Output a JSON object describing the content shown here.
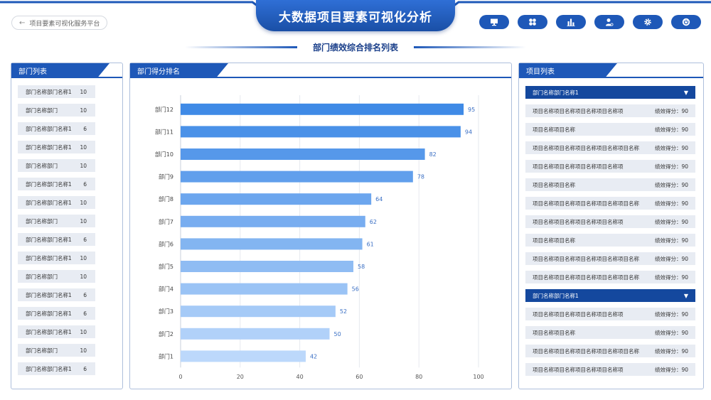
{
  "header": {
    "title": "大数据项目要素可视化分析",
    "back_label": "项目要素可视化服务平台",
    "subtitle": "部门绩效综合排名列表"
  },
  "toolbar": {
    "icons": [
      "monitor-icon",
      "apps-icon",
      "bar-chart-icon",
      "user-icon",
      "gear-icon",
      "power-icon"
    ]
  },
  "colors": {
    "primary": "#1e58b8",
    "dark": "#14489e",
    "bar_top": "#3f8ae6",
    "bar_bottom": "#bcd8fb"
  },
  "dept_panel": {
    "title": "部门列表",
    "items": [
      {
        "name": "部门名称部门名称1",
        "count": "10"
      },
      {
        "name": "部门名称部门",
        "count": "10"
      },
      {
        "name": "部门名称部门名称1",
        "count": "6"
      },
      {
        "name": "部门名称部门名称1",
        "count": "10"
      },
      {
        "name": "部门名称部门",
        "count": "10"
      },
      {
        "name": "部门名称部门名称1",
        "count": "6"
      },
      {
        "name": "部门名称部门名称1",
        "count": "10"
      },
      {
        "name": "部门名称部门",
        "count": "10"
      },
      {
        "name": "部门名称部门名称1",
        "count": "6"
      },
      {
        "name": "部门名称部门名称1",
        "count": "10"
      },
      {
        "name": "部门名称部门",
        "count": "10"
      },
      {
        "name": "部门名称部门名称1",
        "count": "6"
      },
      {
        "name": "部门名称部门名称1",
        "count": "6"
      },
      {
        "name": "部门名称部门名称1",
        "count": "10"
      },
      {
        "name": "部门名称部门",
        "count": "10"
      },
      {
        "name": "部门名称部门名称1",
        "count": "6"
      }
    ]
  },
  "chart_panel": {
    "title": "部门得分排名"
  },
  "chart_data": {
    "type": "bar",
    "orientation": "horizontal",
    "categories": [
      "部门12",
      "部门11",
      "部门10",
      "部门9",
      "部门8",
      "部门7",
      "部门6",
      "部门5",
      "部门4",
      "部门3",
      "部门2",
      "部门1"
    ],
    "values": [
      95,
      94,
      82,
      78,
      64,
      62,
      61,
      58,
      56,
      52,
      50,
      42
    ],
    "xlim": [
      0,
      100
    ],
    "xticks": [
      0,
      20,
      40,
      60,
      80,
      100
    ],
    "grid": true
  },
  "project_panel": {
    "title": "项目列表",
    "groups": [
      {
        "name": "部门名称部门名称1",
        "items": [
          {
            "name": "项目名称项目名称项目名称项目名称项",
            "score": "绩效得分：90"
          },
          {
            "name": "项目名称项目名称",
            "score": "绩效得分：90"
          },
          {
            "name": "项目名称项目名称项目名称项目名称项目名称",
            "score": "绩效得分：90"
          },
          {
            "name": "项目名称项目名称项目名称项目名称项",
            "score": "绩效得分：90"
          },
          {
            "name": "项目名称项目名称",
            "score": "绩效得分：90"
          },
          {
            "name": "项目名称项目名称项目名称项目名称项目名称",
            "score": "绩效得分：90"
          },
          {
            "name": "项目名称项目名称项目名称项目名称项",
            "score": "绩效得分：90"
          },
          {
            "name": "项目名称项目名称",
            "score": "绩效得分：90"
          },
          {
            "name": "项目名称项目名称项目名称项目名称项目名称",
            "score": "绩效得分：90"
          },
          {
            "name": "项目名称项目名称项目名称项目名称项目名称",
            "score": "绩效得分：90"
          }
        ]
      },
      {
        "name": "部门名称部门名称1",
        "items": [
          {
            "name": "项目名称项目名称项目名称项目名称项",
            "score": "绩效得分：90"
          },
          {
            "name": "项目名称项目名称",
            "score": "绩效得分：90"
          },
          {
            "name": "项目名称项目名称项目名称项目名称项目名称",
            "score": "绩效得分：90"
          },
          {
            "name": "项目名称项目名称项目名称项目名称项",
            "score": "绩效得分：90"
          }
        ]
      }
    ]
  }
}
